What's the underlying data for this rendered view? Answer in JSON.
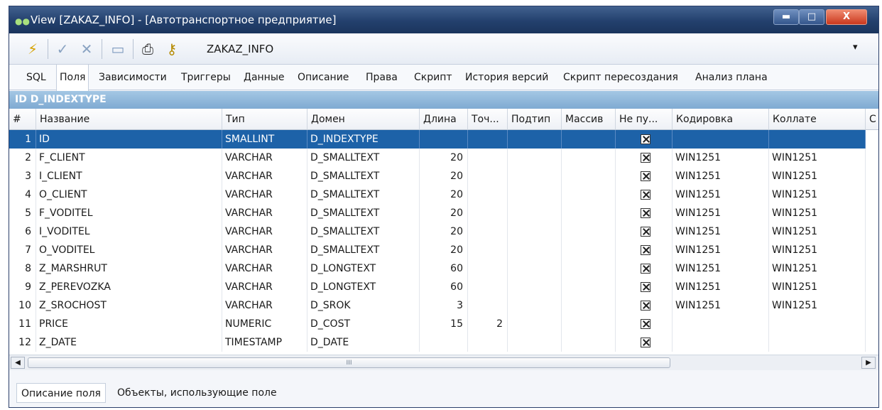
{
  "window": {
    "title": "View [ZAKAZ_INFO] -  [Автотранспортное предприятие]",
    "buttons": {
      "minimize": "▬",
      "maximize": "□",
      "close": "X"
    }
  },
  "toolbar": {
    "object_name": "ZAKAZ_INFO",
    "icons": [
      "lightning-icon",
      "check-icon",
      "cross-icon",
      "window-icon",
      "printer-icon",
      "key-icon"
    ]
  },
  "tabs": [
    "SQL",
    "Поля",
    "Зависимости",
    "Триггеры",
    "Данные",
    "Описание",
    "Права",
    "Скрипт",
    "История версий",
    "Скрипт пересоздания",
    "Анализ плана"
  ],
  "active_tab": "Поля",
  "info_bar": "ID D_INDEXTYPE",
  "grid": {
    "columns": [
      "#",
      "Название",
      "Тип",
      "Домен",
      "Длина",
      "Точ...",
      "Подтип",
      "Массив",
      "Не пу...",
      "Кодировка",
      "Коллате",
      "С"
    ],
    "rows": [
      [
        "1",
        "ID",
        "SMALLINT",
        "D_INDEXTYPE",
        "",
        "",
        "",
        "",
        "x",
        "",
        ""
      ],
      [
        "2",
        "F_CLIENT",
        "VARCHAR",
        "D_SMALLTEXT",
        "20",
        "",
        "",
        "",
        "x",
        "WIN1251",
        "WIN1251"
      ],
      [
        "3",
        "I_CLIENT",
        "VARCHAR",
        "D_SMALLTEXT",
        "20",
        "",
        "",
        "",
        "x",
        "WIN1251",
        "WIN1251"
      ],
      [
        "4",
        "O_CLIENT",
        "VARCHAR",
        "D_SMALLTEXT",
        "20",
        "",
        "",
        "",
        "x",
        "WIN1251",
        "WIN1251"
      ],
      [
        "5",
        "F_VODITEL",
        "VARCHAR",
        "D_SMALLTEXT",
        "20",
        "",
        "",
        "",
        "x",
        "WIN1251",
        "WIN1251"
      ],
      [
        "6",
        "I_VODITEL",
        "VARCHAR",
        "D_SMALLTEXT",
        "20",
        "",
        "",
        "",
        "x",
        "WIN1251",
        "WIN1251"
      ],
      [
        "7",
        "O_VODITEL",
        "VARCHAR",
        "D_SMALLTEXT",
        "20",
        "",
        "",
        "",
        "x",
        "WIN1251",
        "WIN1251"
      ],
      [
        "8",
        "Z_MARSHRUT",
        "VARCHAR",
        "D_LONGTEXT",
        "60",
        "",
        "",
        "",
        "x",
        "WIN1251",
        "WIN1251"
      ],
      [
        "9",
        "Z_PEREVOZKA",
        "VARCHAR",
        "D_LONGTEXT",
        "60",
        "",
        "",
        "",
        "x",
        "WIN1251",
        "WIN1251"
      ],
      [
        "10",
        "Z_SROCHOST",
        "VARCHAR",
        "D_SROK",
        "3",
        "",
        "",
        "",
        "x",
        "WIN1251",
        "WIN1251"
      ],
      [
        "11",
        "PRICE",
        "NUMERIC",
        "D_COST",
        "15",
        "2",
        "",
        "",
        "x",
        "",
        ""
      ],
      [
        "12",
        "Z_DATE",
        "TIMESTAMP",
        "D_DATE",
        "",
        "",
        "",
        "",
        "x",
        "",
        ""
      ]
    ],
    "selected_row": 1
  },
  "scrollbar": {
    "thumb_text": "III"
  },
  "bottom_tabs": [
    "Описание поля",
    "Объекты, использующие поле"
  ]
}
